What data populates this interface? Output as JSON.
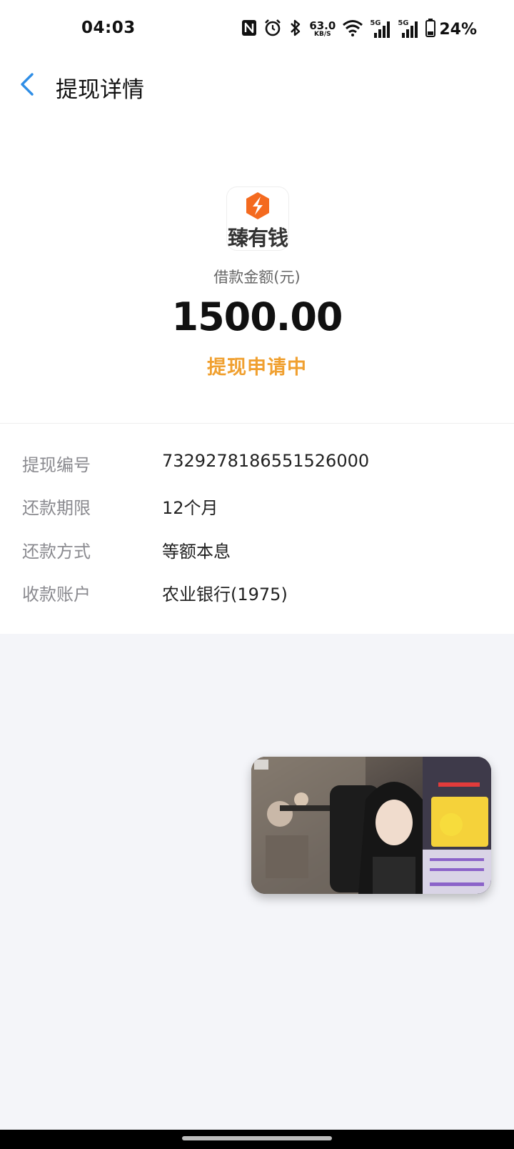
{
  "status_bar": {
    "time": "04:03",
    "net_speed_value": "63.0",
    "net_speed_unit": "KB/S",
    "signal_1_label": "5G",
    "signal_2_label": "5G",
    "battery_percent": "24%"
  },
  "header": {
    "title": "提现详情"
  },
  "summary": {
    "app_name": "臻有钱",
    "amount_label": "借款金额(元)",
    "amount_value": "1500.00",
    "status": "提现申请中"
  },
  "details": [
    {
      "label": "提现编号",
      "value": "7329278186551526000"
    },
    {
      "label": "还款期限",
      "value": "12个月"
    },
    {
      "label": "还款方式",
      "value": "等额本息"
    },
    {
      "label": "收款账户",
      "value": "农业银行(1975)"
    }
  ],
  "colors": {
    "accent_blue": "#2f8ee6",
    "status_orange": "#f0a030",
    "logo_orange": "#f46a1f",
    "page_bg": "#f4f5f9"
  },
  "icons": {
    "back": "chevron-left-icon",
    "nfc": "nfc-icon",
    "alarm": "alarm-icon",
    "bluetooth": "bluetooth-icon",
    "wifi": "wifi-icon",
    "signal": "signal-icon",
    "battery": "battery-icon"
  }
}
